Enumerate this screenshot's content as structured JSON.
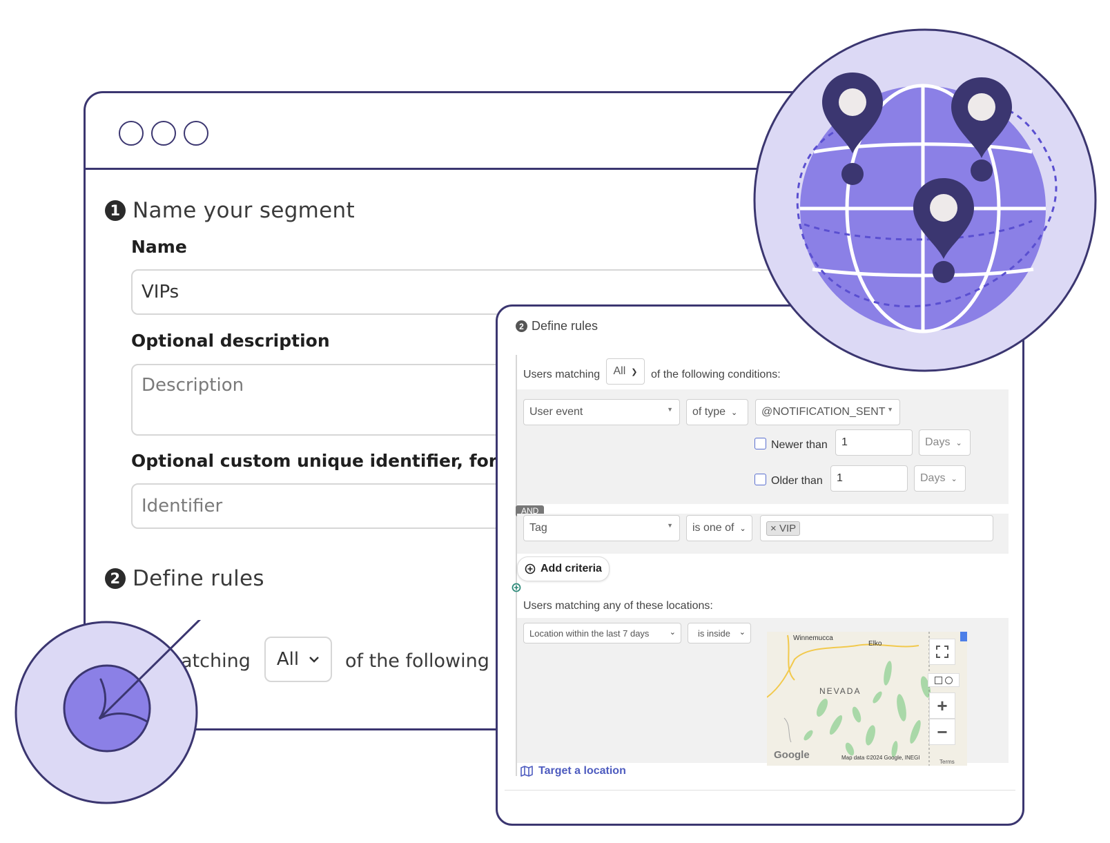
{
  "back_window": {
    "step1": {
      "number": "1",
      "heading": "Name your segment"
    },
    "name_label": "Name",
    "name_value": "VIPs",
    "description_label": "Optional description",
    "description_placeholder": "Description",
    "identifier_label": "Optional custom unique identifier, for us",
    "identifier_placeholder": "Identifier",
    "step2": {
      "number": "2",
      "heading": "Define rules"
    },
    "users_matching_partial": "atching",
    "match_select": "All",
    "following_partial": "of the following"
  },
  "front_window": {
    "step2": {
      "number": "2",
      "heading": "Define rules"
    },
    "users_matching": "Users matching",
    "match_select": "All",
    "of_following_conditions": "of the following conditions:",
    "condition1": {
      "field": "User event",
      "operator": "of type",
      "value": "@NOTIFICATION_SENT",
      "newer_than_label": "Newer than",
      "newer_than_value": "1",
      "newer_than_unit": "Days",
      "older_than_label": "Older than",
      "older_than_value": "1",
      "older_than_unit": "Days"
    },
    "and_badge": "AND",
    "condition2": {
      "field": "Tag",
      "operator": "is one of",
      "tag_remove": "×",
      "tag_value": "VIP"
    },
    "add_criteria": "Add criteria",
    "locations_label": "Users matching any of these locations:",
    "location_rule": {
      "field": "Location within the last 7 days",
      "operator": "is inside"
    },
    "map": {
      "labels": [
        "Winnemucca",
        "Elko",
        "NEVADA"
      ],
      "logo": "Google",
      "attribution": "Map data ©2024 Google, INEGI",
      "terms": "Terms",
      "zoom_in": "+",
      "zoom_out": "−"
    },
    "target_location": "Target a location"
  },
  "colors": {
    "outline": "#3b3670",
    "lavender": "#dcd9f5",
    "purple": "#8b80e6",
    "dark_purple": "#3b3670",
    "link_blue": "#4d5bbf"
  },
  "icons": [
    "globe-icon",
    "map-pin-icon",
    "arrow-target-icon",
    "add-circle-icon",
    "map-icon",
    "fullscreen-icon",
    "chevron-down-icon",
    "close-icon"
  ]
}
